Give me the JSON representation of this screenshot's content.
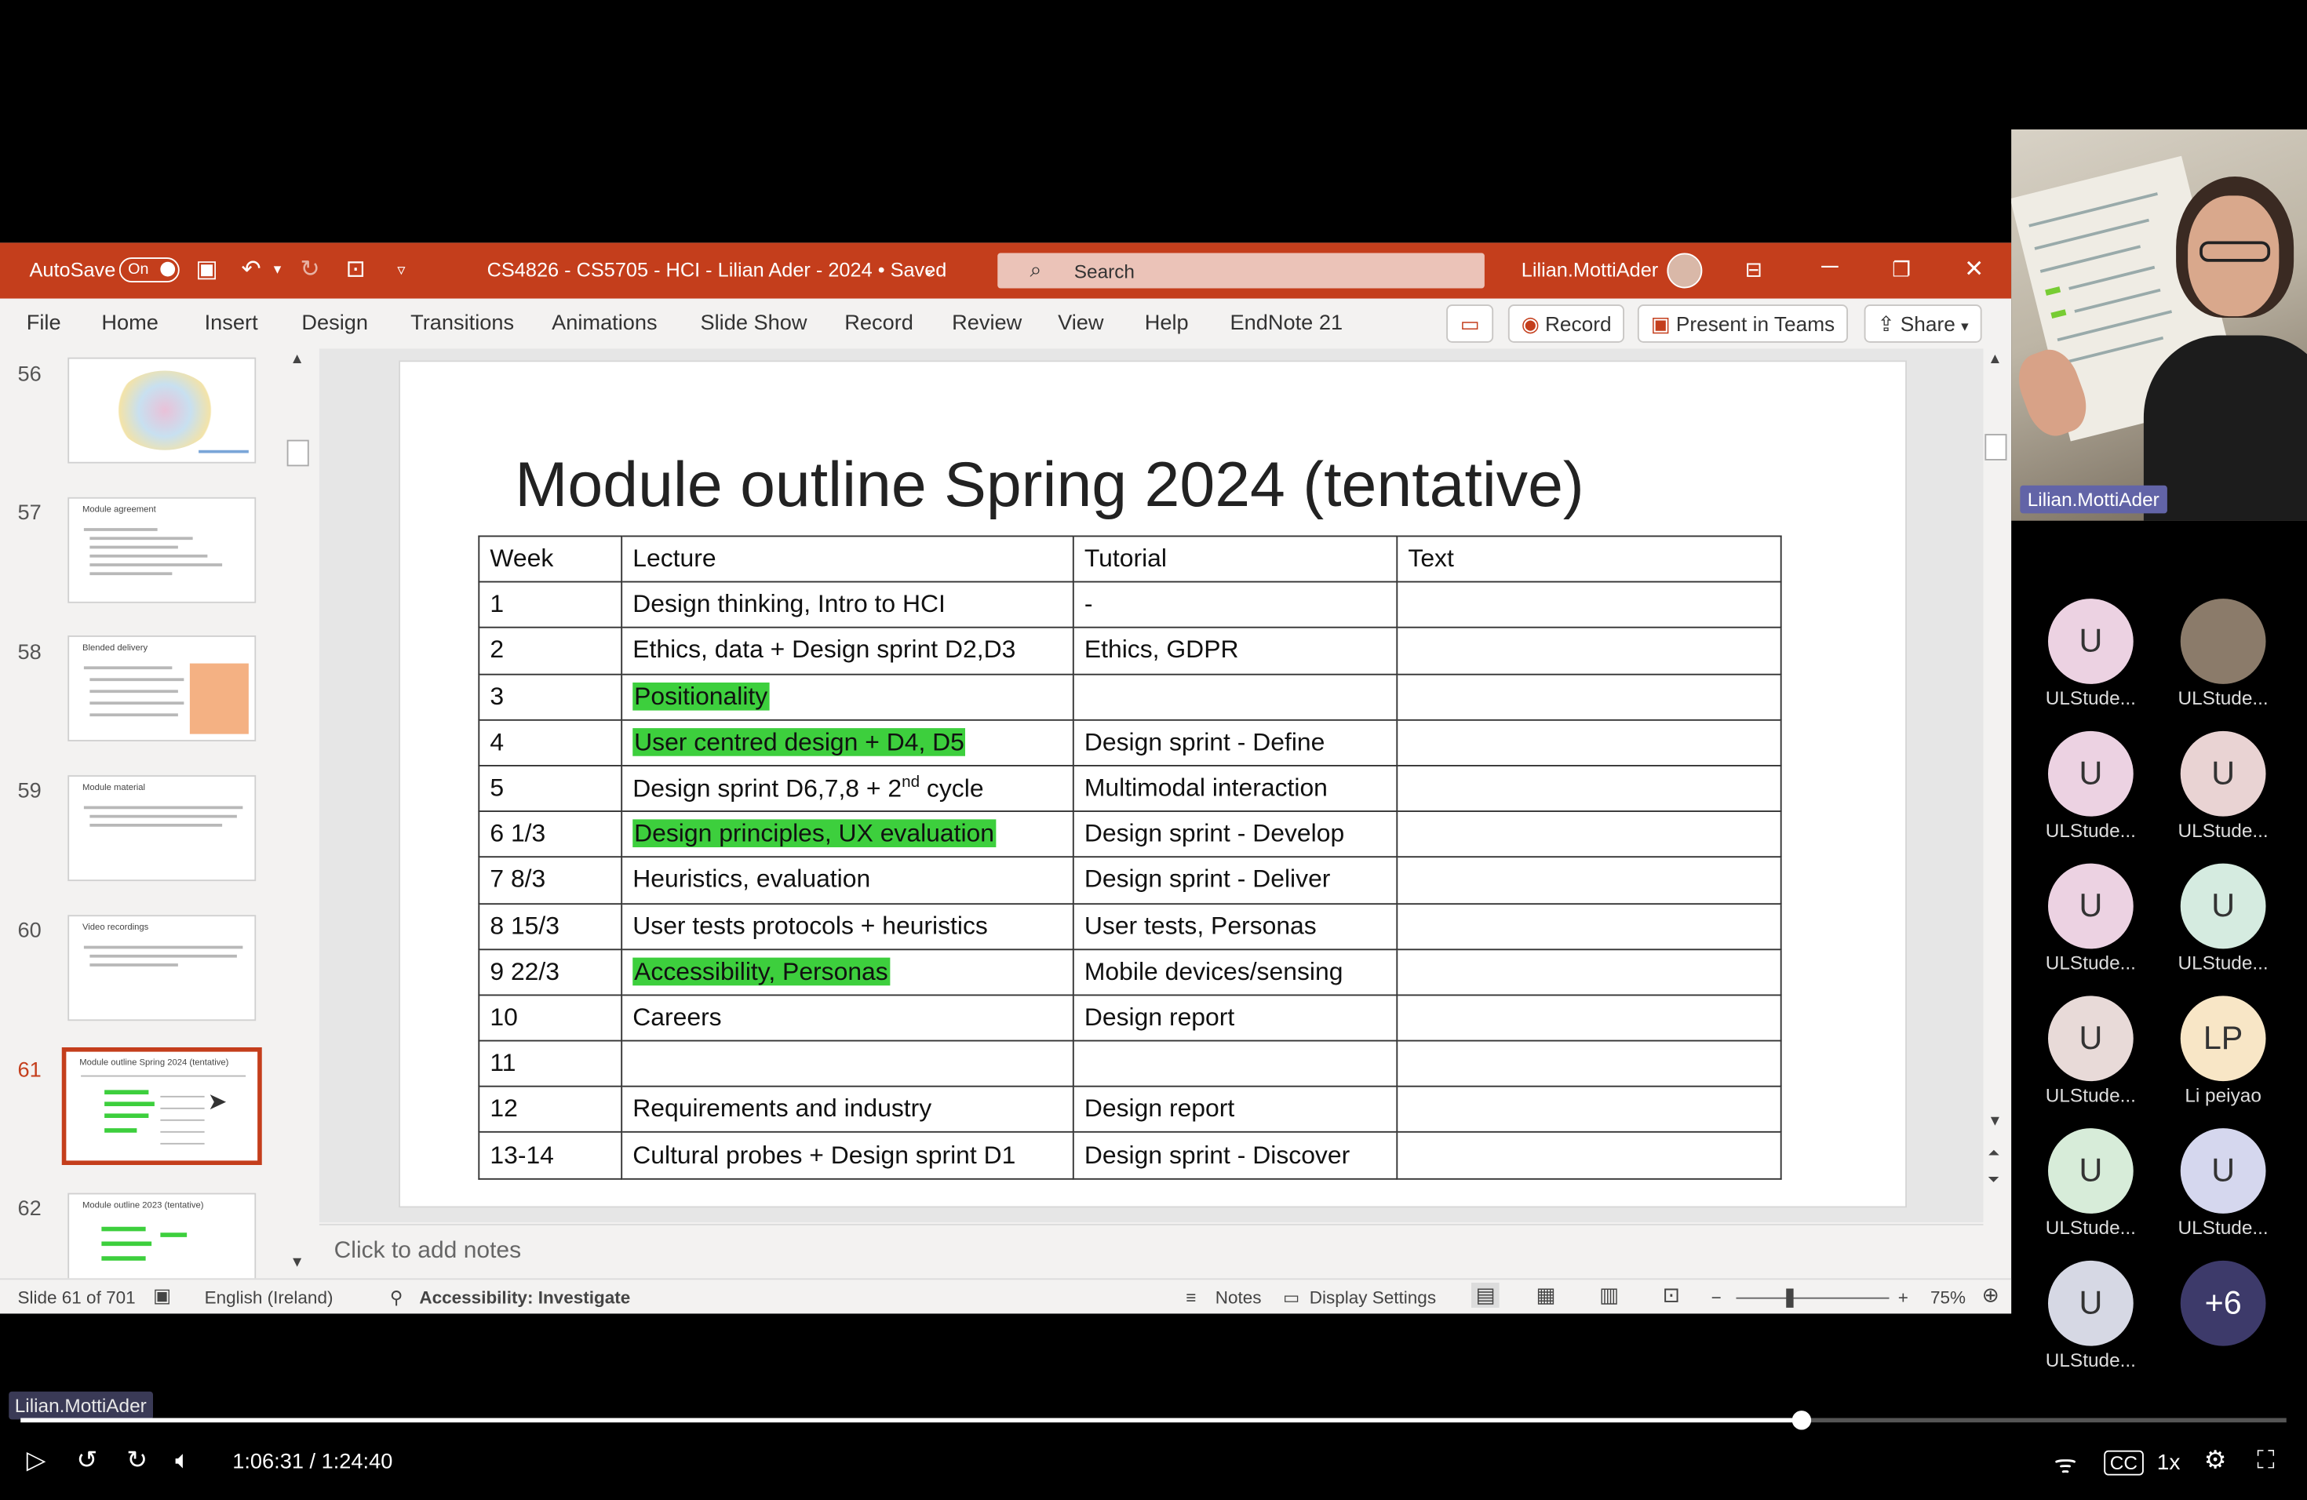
{
  "window": {
    "autosave_label": "AutoSave",
    "autosave_state": "On",
    "doc_title": "CS4826 - CS5705 - HCI - Lilian Ader - 2024 • Saved",
    "search_placeholder": "Search",
    "user_name": "Lilian.MottiAder",
    "accent_color": "#c43e1c"
  },
  "ribbon": {
    "tabs": [
      "File",
      "Home",
      "Insert",
      "Design",
      "Transitions",
      "Animations",
      "Slide Show",
      "Record",
      "Review",
      "View",
      "Help",
      "EndNote 21"
    ],
    "record_label": "Record",
    "present_label": "Present in Teams",
    "share_label": "Share"
  },
  "thumbnails": [
    {
      "num": "56",
      "title": ""
    },
    {
      "num": "57",
      "title": "Module agreement"
    },
    {
      "num": "58",
      "title": "Blended delivery"
    },
    {
      "num": "59",
      "title": "Module material"
    },
    {
      "num": "60",
      "title": "Video recordings"
    },
    {
      "num": "61",
      "title": "Module outline Spring 2024 (tentative)"
    },
    {
      "num": "62",
      "title": "Module outline 2023 (tentative)"
    }
  ],
  "slide": {
    "title": "Module outline Spring 2024 (tentative)",
    "headers": [
      "Week",
      "Lecture",
      "Tutorial",
      "Text"
    ],
    "rows": [
      {
        "week": "1",
        "lecture": "Design thinking, Intro to HCI",
        "tutorial": "-",
        "text": "",
        "highlight": false
      },
      {
        "week": "2",
        "lecture": "Ethics, data + Design sprint D2,D3",
        "tutorial": "Ethics, GDPR",
        "text": "",
        "highlight": false
      },
      {
        "week": "3",
        "lecture": "Positionality",
        "tutorial": "",
        "text": "",
        "highlight": true
      },
      {
        "week": "4",
        "lecture": "User centred design + D4, D5",
        "tutorial": "Design sprint - Define",
        "text": "",
        "highlight": true
      },
      {
        "week": "5",
        "lecture_pre": "Design sprint D6,7,8 + 2",
        "lecture_sup": "nd",
        "lecture_post": " cycle",
        "tutorial": "Multimodal interaction",
        "text": "",
        "highlight": false
      },
      {
        "week": "6 1/3",
        "lecture": "Design principles, UX evaluation",
        "tutorial": "Design sprint - Develop",
        "text": "",
        "highlight": true
      },
      {
        "week": "7 8/3",
        "lecture": "Heuristics, evaluation",
        "tutorial": "Design sprint - Deliver",
        "text": "",
        "highlight": false
      },
      {
        "week": "8 15/3",
        "lecture": "User tests protocols + heuristics",
        "tutorial": "User tests, Personas",
        "text": "",
        "highlight": false
      },
      {
        "week": "9 22/3",
        "lecture": "Accessibility, Personas",
        "tutorial": "Mobile devices/sensing",
        "text": "",
        "highlight": true
      },
      {
        "week": "10",
        "lecture": "Careers",
        "tutorial": "Design report",
        "text": "",
        "highlight": false
      },
      {
        "week": "11",
        "lecture": "",
        "tutorial": "",
        "text": "",
        "highlight": false
      },
      {
        "week": "12",
        "lecture": "Requirements and industry",
        "tutorial": "Design report",
        "text": "",
        "highlight": false
      },
      {
        "week": "13-14",
        "lecture": "Cultural probes + Design sprint D1",
        "tutorial": "Design sprint - Discover",
        "text": "",
        "highlight": false
      }
    ],
    "highlight_color": "#3dcf3d"
  },
  "notes": {
    "placeholder": "Click to add notes"
  },
  "status": {
    "slide_counter": "Slide 61 of 701",
    "language": "English (Ireland)",
    "accessibility": "Accessibility: Investigate",
    "notes": "Notes",
    "display_settings": "Display Settings",
    "zoom": "75%"
  },
  "meeting": {
    "speaker_name": "Lilian.MottiAder",
    "participants": [
      {
        "initials": "U",
        "name": "ULStude...",
        "color": "#ecd2e2"
      },
      {
        "initials": "",
        "name": "ULStude...",
        "color": "#8b7b6a"
      },
      {
        "initials": "U",
        "name": "ULStude...",
        "color": "#ecd2e2"
      },
      {
        "initials": "U",
        "name": "ULStude...",
        "color": "#e9d3d3"
      },
      {
        "initials": "U",
        "name": "ULStude...",
        "color": "#ecd2e2"
      },
      {
        "initials": "U",
        "name": "ULStude...",
        "color": "#d5ebe0"
      },
      {
        "initials": "U",
        "name": "ULStude...",
        "color": "#e8dad8"
      },
      {
        "initials": "LP",
        "name": "Li peiyao",
        "color": "#f8e6c6"
      },
      {
        "initials": "U",
        "name": "ULStude...",
        "color": "#d7ecd9"
      },
      {
        "initials": "U",
        "name": "ULStude...",
        "color": "#d5d7ee"
      },
      {
        "initials": "U",
        "name": "ULStude...",
        "color": "#d6d8e4"
      },
      {
        "initials": "+6",
        "name": "",
        "color": "#3d3a6a"
      }
    ]
  },
  "player": {
    "presenter_tag": "Lilian.MottiAder",
    "time": "1:06:31 / 1:24:40",
    "progress": 0.786,
    "speed": "1x"
  }
}
